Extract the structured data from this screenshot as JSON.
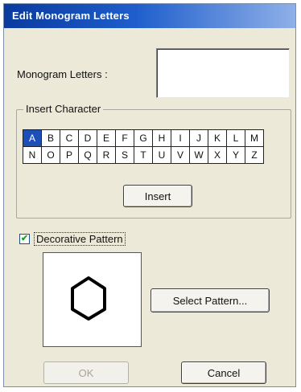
{
  "window": {
    "title": "Edit Monogram Letters"
  },
  "monogram": {
    "label": "Monogram Letters :",
    "value": ""
  },
  "insert_character": {
    "legend": "Insert Character",
    "selected": "A",
    "rows": [
      [
        "A",
        "B",
        "C",
        "D",
        "E",
        "F",
        "G",
        "H",
        "I",
        "J",
        "K",
        "L",
        "M"
      ],
      [
        "N",
        "O",
        "P",
        "Q",
        "R",
        "S",
        "T",
        "U",
        "V",
        "W",
        "X",
        "Y",
        "Z"
      ]
    ],
    "insert_label": "Insert"
  },
  "decorative": {
    "checked": true,
    "label": "Decorative Pattern",
    "pattern_icon": "hexagon-outline",
    "select_pattern_label": "Select Pattern..."
  },
  "footer": {
    "ok_label": "OK",
    "ok_enabled": false,
    "cancel_label": "Cancel"
  },
  "colors": {
    "title_bar": "#1e5ecc",
    "dialog_bg": "#ece9d8",
    "selection": "#1d4fb8",
    "check_mark": "#21a121"
  }
}
